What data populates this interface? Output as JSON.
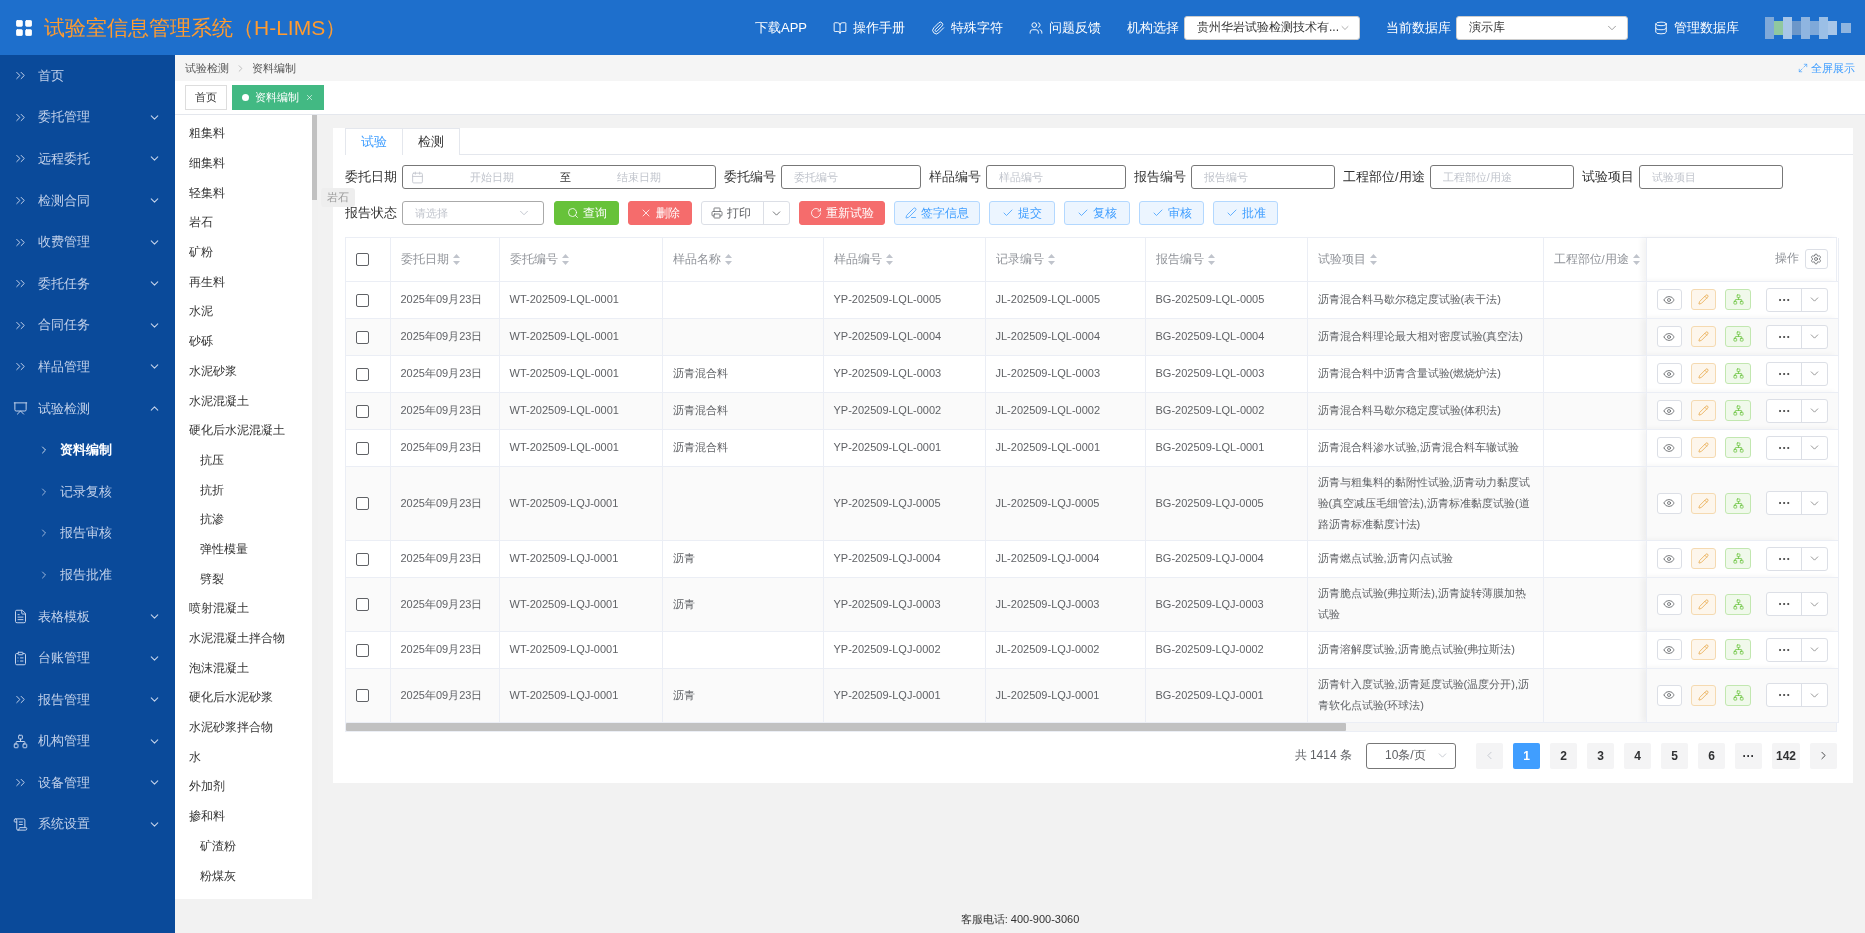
{
  "header": {
    "title": "试验室信息管理系统（H-LIMS）",
    "nav": [
      {
        "label": "下载APP"
      },
      {
        "label": "操作手册"
      },
      {
        "label": "特殊字符"
      },
      {
        "label": "问题反馈"
      }
    ],
    "org_select": {
      "label": "机构选择",
      "value": "贵州华岩试验检测技术有..."
    },
    "db_select": {
      "label": "当前数据库",
      "value": "演示库"
    },
    "manage_db": "管理数据库"
  },
  "sidebar": {
    "items": [
      {
        "label": "首页"
      },
      {
        "label": "委托管理",
        "expanded": false
      },
      {
        "label": "远程委托",
        "expanded": false
      },
      {
        "label": "检测合同",
        "expanded": false
      },
      {
        "label": "收费管理",
        "expanded": false
      },
      {
        "label": "委托任务",
        "expanded": false
      },
      {
        "label": "合同任务",
        "expanded": false
      },
      {
        "label": "样品管理",
        "expanded": false
      },
      {
        "label": "试验检测",
        "expanded": true,
        "children": [
          {
            "label": "资料编制",
            "selected": true
          },
          {
            "label": "记录复核",
            "selected": false
          },
          {
            "label": "报告审核",
            "selected": false
          },
          {
            "label": "报告批准",
            "selected": false
          }
        ]
      },
      {
        "label": "表格模板",
        "expanded": false
      },
      {
        "label": "台账管理",
        "expanded": false
      },
      {
        "label": "报告管理",
        "expanded": false
      },
      {
        "label": "机构管理",
        "expanded": false
      },
      {
        "label": "设备管理",
        "expanded": false
      },
      {
        "label": "系统设置",
        "expanded": false
      }
    ]
  },
  "breadcrumb": [
    "试验检测",
    "资料编制"
  ],
  "fullscreen_link": "全屏展示",
  "page_tabs": [
    {
      "label": "首页",
      "selected": false
    },
    {
      "label": "资料编制",
      "selected": true
    }
  ],
  "material_tree": [
    {
      "label": "粗集料"
    },
    {
      "label": "细集料"
    },
    {
      "label": "轻集料"
    },
    {
      "label": "岩石"
    },
    {
      "label": "矿粉"
    },
    {
      "label": "再生料"
    },
    {
      "label": "水泥"
    },
    {
      "label": "砂砾"
    },
    {
      "label": "水泥砂浆"
    },
    {
      "label": "水泥混凝土"
    },
    {
      "label": "硬化后水泥混凝土",
      "children": [
        {
          "label": "抗压"
        },
        {
          "label": "抗折"
        },
        {
          "label": "抗渗"
        },
        {
          "label": "弹性模量"
        },
        {
          "label": "劈裂"
        }
      ]
    },
    {
      "label": "喷射混凝土"
    },
    {
      "label": "水泥混凝土拌合物"
    },
    {
      "label": "泡沫混凝土"
    },
    {
      "label": "硬化后水泥砂浆"
    },
    {
      "label": "水泥砂浆拌合物"
    },
    {
      "label": "水"
    },
    {
      "label": "外加剂"
    },
    {
      "label": "掺和料",
      "children": [
        {
          "label": "矿渣粉"
        },
        {
          "label": "粉煤灰"
        }
      ]
    }
  ],
  "tooltip": "岩石",
  "content_tabs": [
    {
      "label": "试验",
      "selected": true
    },
    {
      "label": "检测",
      "selected": false
    }
  ],
  "filters": [
    {
      "kind": "date_range",
      "label": "委托日期",
      "start_placeholder": "开始日期",
      "separator": "至",
      "end_placeholder": "结束日期"
    },
    {
      "kind": "text",
      "label": "委托编号",
      "placeholder": "委托编号"
    },
    {
      "kind": "text",
      "label": "样品编号",
      "placeholder": "样品编号"
    },
    {
      "kind": "text",
      "label": "报告编号",
      "placeholder": "报告编号"
    },
    {
      "kind": "text",
      "label": "工程部位/用途",
      "placeholder": "工程部位/用途"
    },
    {
      "kind": "text",
      "label": "试验项目",
      "placeholder": "试验项目"
    }
  ],
  "status_filter": {
    "label": "报告状态",
    "placeholder": "请选择"
  },
  "actions": [
    {
      "kind": "query",
      "label": "查询"
    },
    {
      "kind": "delete",
      "label": "删除"
    },
    {
      "kind": "print",
      "label": "打印"
    },
    {
      "kind": "retest",
      "label": "重新试验"
    },
    {
      "kind": "sign",
      "label": "签字信息"
    },
    {
      "kind": "approve",
      "label": "提交"
    },
    {
      "kind": "approve",
      "label": "复核"
    },
    {
      "kind": "approve",
      "label": "审核"
    },
    {
      "kind": "approve",
      "label": "批准"
    }
  ],
  "table": {
    "select_all_checked": false,
    "columns": [
      {
        "label": "委托日期",
        "sortable": true
      },
      {
        "label": "委托编号",
        "sortable": true
      },
      {
        "label": "样品名称",
        "sortable": true
      },
      {
        "label": "样品编号",
        "sortable": true
      },
      {
        "label": "记录编号",
        "sortable": true
      },
      {
        "label": "报告编号",
        "sortable": true
      },
      {
        "label": "试验项目",
        "sortable": true
      },
      {
        "label": "工程部位/用途",
        "sortable": true
      },
      {
        "label": "操作",
        "sortable": false
      }
    ],
    "rows": [
      {
        "checked": false,
        "date": "2025年09月23日",
        "order_no": "WT-202509-LQL-0001",
        "sample_no": "YP-202509-LQL-0005",
        "record_no": "JL-202509-LQL-0005",
        "report_no": "BG-202509-LQL-0005",
        "items": "沥青混合料马歇尔稳定度试验(表干法)"
      },
      {
        "checked": false,
        "date": "2025年09月23日",
        "order_no": "WT-202509-LQL-0001",
        "sample_no": "YP-202509-LQL-0004",
        "record_no": "JL-202509-LQL-0004",
        "report_no": "BG-202509-LQL-0004",
        "items": "沥青混合料理论最大相对密度试验(真空法)"
      },
      {
        "checked": false,
        "date": "2025年09月23日",
        "order_no": "WT-202509-LQL-0001",
        "sample_name": "沥青混合料",
        "sample_no": "YP-202509-LQL-0003",
        "record_no": "JL-202509-LQL-0003",
        "report_no": "BG-202509-LQL-0003",
        "items": "沥青混合料中沥青含量试验(燃烧炉法)"
      },
      {
        "checked": false,
        "date": "2025年09月23日",
        "order_no": "WT-202509-LQL-0001",
        "sample_name": "沥青混合料",
        "sample_no": "YP-202509-LQL-0002",
        "record_no": "JL-202509-LQL-0002",
        "report_no": "BG-202509-LQL-0002",
        "items": "沥青混合料马歇尔稳定度试验(体积法)"
      },
      {
        "checked": false,
        "date": "2025年09月23日",
        "order_no": "WT-202509-LQL-0001",
        "sample_name": "沥青混合料",
        "sample_no": "YP-202509-LQL-0001",
        "record_no": "JL-202509-LQL-0001",
        "report_no": "BG-202509-LQL-0001",
        "items": "沥青混合料渗水试验,沥青混合料车辙试验"
      },
      {
        "checked": false,
        "date": "2025年09月23日",
        "order_no": "WT-202509-LQJ-0001",
        "sample_no": "YP-202509-LQJ-0005",
        "record_no": "JL-202509-LQJ-0005",
        "report_no": "BG-202509-LQJ-0005",
        "items": "沥青与粗集料的黏附性试验,沥青动力黏度试验(真空减压毛细管法),沥青标准黏度试验(道路沥青标准黏度计法)"
      },
      {
        "checked": false,
        "date": "2025年09月23日",
        "order_no": "WT-202509-LQJ-0001",
        "sample_name": "沥青",
        "sample_no": "YP-202509-LQJ-0004",
        "record_no": "JL-202509-LQJ-0004",
        "report_no": "BG-202509-LQJ-0004",
        "items": "沥青燃点试验,沥青闪点试验"
      },
      {
        "checked": false,
        "date": "2025年09月23日",
        "order_no": "WT-202509-LQJ-0001",
        "sample_name": "沥青",
        "sample_no": "YP-202509-LQJ-0003",
        "record_no": "JL-202509-LQJ-0003",
        "report_no": "BG-202509-LQJ-0003",
        "items": "沥青脆点试验(弗拉斯法),沥青旋转薄膜加热试验"
      },
      {
        "checked": false,
        "date": "2025年09月23日",
        "order_no": "WT-202509-LQJ-0001",
        "sample_no": "YP-202509-LQJ-0002",
        "record_no": "JL-202509-LQJ-0002",
        "report_no": "BG-202509-LQJ-0002",
        "items": "沥青溶解度试验,沥青脆点试验(弗拉斯法)"
      },
      {
        "checked": false,
        "date": "2025年09月23日",
        "order_no": "WT-202509-LQJ-0001",
        "sample_name": "沥青",
        "sample_no": "YP-202509-LQJ-0001",
        "record_no": "JL-202509-LQJ-0001",
        "report_no": "BG-202509-LQJ-0001",
        "items": "沥青针入度试验,沥青延度试验(温度分开),沥青软化点试验(环球法)"
      }
    ]
  },
  "pagination": {
    "total": "共 1414 条",
    "page_size": "10条/页",
    "prev_disabled": true,
    "pages": [
      {
        "label": "1",
        "selected": true
      },
      {
        "label": "2",
        "selected": false
      },
      {
        "label": "3",
        "selected": false
      },
      {
        "label": "4",
        "selected": false
      },
      {
        "label": "5",
        "selected": false
      },
      {
        "label": "6",
        "selected": false
      },
      {
        "label": "···",
        "selected": false
      },
      {
        "label": "142",
        "selected": false
      }
    ]
  },
  "footer": "客服电话: 400-900-3060"
}
